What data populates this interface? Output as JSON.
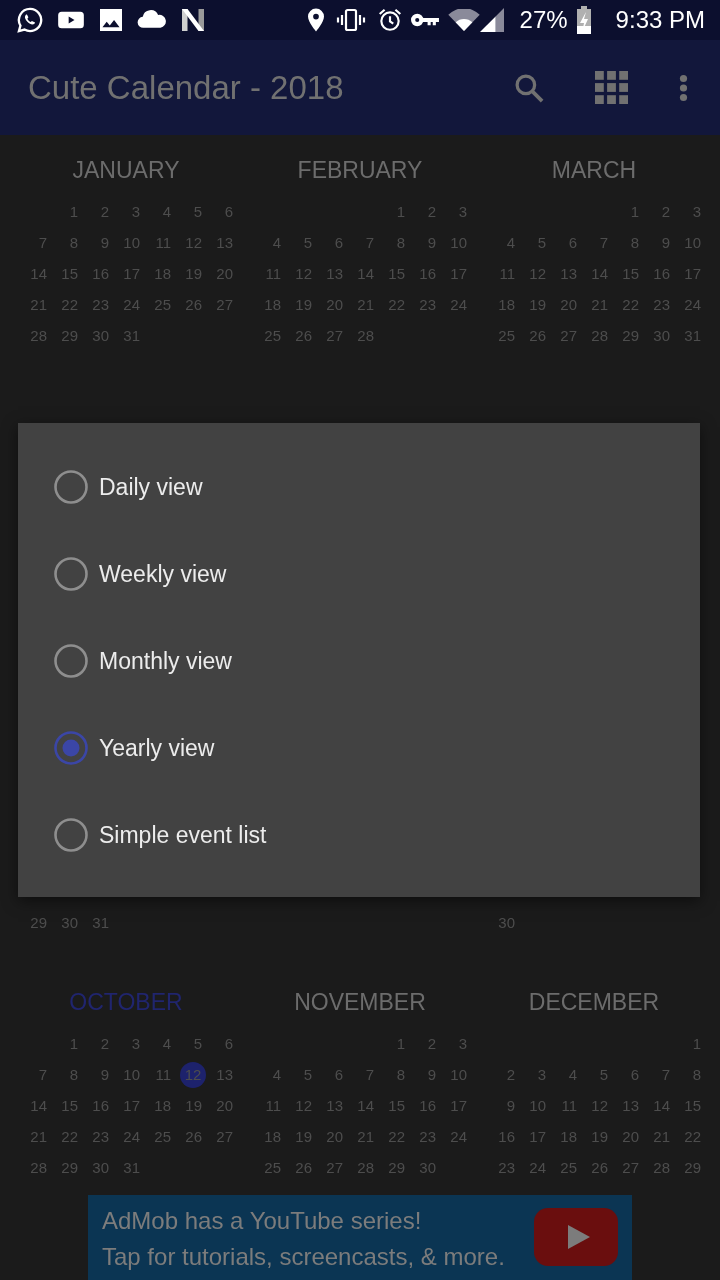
{
  "status_bar": {
    "battery": "27%",
    "time": "9:33 PM"
  },
  "app_bar": {
    "title": "Cute Calendar - 2018"
  },
  "calendar": {
    "upper_months": [
      {
        "name": "JANUARY",
        "current": false,
        "weeks": [
          [
            {
              "day": "1",
              "today": false
            },
            {
              "day": "2",
              "today": false
            },
            {
              "day": "3",
              "today": false
            },
            {
              "day": "4",
              "today": false
            },
            {
              "day": "5",
              "today": false
            },
            {
              "day": "6",
              "today": false
            }
          ],
          [
            {
              "day": "7",
              "today": false
            },
            {
              "day": "8",
              "today": false
            },
            {
              "day": "9",
              "today": false
            },
            {
              "day": "10",
              "today": false
            },
            {
              "day": "11",
              "today": false
            },
            {
              "day": "12",
              "today": false
            },
            {
              "day": "13",
              "today": false
            }
          ],
          [
            {
              "day": "14",
              "today": false
            },
            {
              "day": "15",
              "today": false
            },
            {
              "day": "16",
              "today": false
            },
            {
              "day": "17",
              "today": false
            },
            {
              "day": "18",
              "today": false
            },
            {
              "day": "19",
              "today": false
            },
            {
              "day": "20",
              "today": false
            }
          ],
          [
            {
              "day": "21",
              "today": false
            },
            {
              "day": "22",
              "today": false
            },
            {
              "day": "23",
              "today": false
            },
            {
              "day": "24",
              "today": false
            },
            {
              "day": "25",
              "today": false
            },
            {
              "day": "26",
              "today": false
            },
            {
              "day": "27",
              "today": false
            }
          ],
          [
            {
              "day": "28",
              "today": false
            },
            {
              "day": "29",
              "today": false
            },
            {
              "day": "30",
              "today": false
            },
            {
              "day": "31",
              "today": false
            }
          ]
        ]
      },
      {
        "name": "FEBRUARY",
        "current": false,
        "weeks": [
          [
            {
              "day": "1",
              "today": false
            },
            {
              "day": "2",
              "today": false
            },
            {
              "day": "3",
              "today": false
            }
          ],
          [
            {
              "day": "4",
              "today": false
            },
            {
              "day": "5",
              "today": false
            },
            {
              "day": "6",
              "today": false
            },
            {
              "day": "7",
              "today": false
            },
            {
              "day": "8",
              "today": false
            },
            {
              "day": "9",
              "today": false
            },
            {
              "day": "10",
              "today": false
            }
          ],
          [
            {
              "day": "11",
              "today": false
            },
            {
              "day": "12",
              "today": false
            },
            {
              "day": "13",
              "today": false
            },
            {
              "day": "14",
              "today": false
            },
            {
              "day": "15",
              "today": false
            },
            {
              "day": "16",
              "today": false
            },
            {
              "day": "17",
              "today": false
            }
          ],
          [
            {
              "day": "18",
              "today": false
            },
            {
              "day": "19",
              "today": false
            },
            {
              "day": "20",
              "today": false
            },
            {
              "day": "21",
              "today": false
            },
            {
              "day": "22",
              "today": false
            },
            {
              "day": "23",
              "today": false
            },
            {
              "day": "24",
              "today": false
            }
          ],
          [
            {
              "day": "25",
              "today": false
            },
            {
              "day": "26",
              "today": false
            },
            {
              "day": "27",
              "today": false
            },
            {
              "day": "28",
              "today": false
            }
          ]
        ]
      },
      {
        "name": "MARCH",
        "current": false,
        "weeks": [
          [
            {
              "day": "1",
              "today": false
            },
            {
              "day": "2",
              "today": false
            },
            {
              "day": "3",
              "today": false
            }
          ],
          [
            {
              "day": "4",
              "today": false
            },
            {
              "day": "5",
              "today": false
            },
            {
              "day": "6",
              "today": false
            },
            {
              "day": "7",
              "today": false
            },
            {
              "day": "8",
              "today": false
            },
            {
              "day": "9",
              "today": false
            },
            {
              "day": "10",
              "today": false
            }
          ],
          [
            {
              "day": "11",
              "today": false
            },
            {
              "day": "12",
              "today": false
            },
            {
              "day": "13",
              "today": false
            },
            {
              "day": "14",
              "today": false
            },
            {
              "day": "15",
              "today": false
            },
            {
              "day": "16",
              "today": false
            },
            {
              "day": "17",
              "today": false
            }
          ],
          [
            {
              "day": "18",
              "today": false
            },
            {
              "day": "19",
              "today": false
            },
            {
              "day": "20",
              "today": false
            },
            {
              "day": "21",
              "today": false
            },
            {
              "day": "22",
              "today": false
            },
            {
              "day": "23",
              "today": false
            },
            {
              "day": "24",
              "today": false
            }
          ],
          [
            {
              "day": "25",
              "today": false
            },
            {
              "day": "26",
              "today": false
            },
            {
              "day": "27",
              "today": false
            },
            {
              "day": "28",
              "today": false
            },
            {
              "day": "29",
              "today": false
            },
            {
              "day": "30",
              "today": false
            },
            {
              "day": "31",
              "today": false
            }
          ]
        ]
      }
    ],
    "row_below_dialog": {
      "first_month": [
        {
          "day": "29",
          "today": false
        },
        {
          "day": "30",
          "today": false
        },
        {
          "day": "31",
          "today": false
        }
      ],
      "third_month": [
        {
          "day": "30",
          "today": false
        }
      ]
    },
    "lower_months": [
      {
        "name": "OCTOBER",
        "current": true,
        "weeks": [
          [
            {
              "day": "1",
              "today": false
            },
            {
              "day": "2",
              "today": false
            },
            {
              "day": "3",
              "today": false
            },
            {
              "day": "4",
              "today": false
            },
            {
              "day": "5",
              "today": false
            },
            {
              "day": "6",
              "today": false
            }
          ],
          [
            {
              "day": "7",
              "today": false
            },
            {
              "day": "8",
              "today": false
            },
            {
              "day": "9",
              "today": false
            },
            {
              "day": "10",
              "today": false
            },
            {
              "day": "11",
              "today": false
            },
            {
              "day": "12",
              "today": true
            },
            {
              "day": "13",
              "today": false
            }
          ],
          [
            {
              "day": "14",
              "today": false
            },
            {
              "day": "15",
              "today": false
            },
            {
              "day": "16",
              "today": false
            },
            {
              "day": "17",
              "today": false
            },
            {
              "day": "18",
              "today": false
            },
            {
              "day": "19",
              "today": false
            },
            {
              "day": "20",
              "today": false
            }
          ],
          [
            {
              "day": "21",
              "today": false
            },
            {
              "day": "22",
              "today": false
            },
            {
              "day": "23",
              "today": false
            },
            {
              "day": "24",
              "today": false
            },
            {
              "day": "25",
              "today": false
            },
            {
              "day": "26",
              "today": false
            },
            {
              "day": "27",
              "today": false
            }
          ],
          [
            {
              "day": "28",
              "today": false
            },
            {
              "day": "29",
              "today": false
            },
            {
              "day": "30",
              "today": false
            },
            {
              "day": "31",
              "today": false
            }
          ]
        ]
      },
      {
        "name": "NOVEMBER",
        "current": false,
        "weeks": [
          [
            {
              "day": "1",
              "today": false
            },
            {
              "day": "2",
              "today": false
            },
            {
              "day": "3",
              "today": false
            }
          ],
          [
            {
              "day": "4",
              "today": false
            },
            {
              "day": "5",
              "today": false
            },
            {
              "day": "6",
              "today": false
            },
            {
              "day": "7",
              "today": false
            },
            {
              "day": "8",
              "today": false
            },
            {
              "day": "9",
              "today": false
            },
            {
              "day": "10",
              "today": false
            }
          ],
          [
            {
              "day": "11",
              "today": false
            },
            {
              "day": "12",
              "today": false
            },
            {
              "day": "13",
              "today": false
            },
            {
              "day": "14",
              "today": false
            },
            {
              "day": "15",
              "today": false
            },
            {
              "day": "16",
              "today": false
            },
            {
              "day": "17",
              "today": false
            }
          ],
          [
            {
              "day": "18",
              "today": false
            },
            {
              "day": "19",
              "today": false
            },
            {
              "day": "20",
              "today": false
            },
            {
              "day": "21",
              "today": false
            },
            {
              "day": "22",
              "today": false
            },
            {
              "day": "23",
              "today": false
            },
            {
              "day": "24",
              "today": false
            }
          ],
          [
            {
              "day": "25",
              "today": false
            },
            {
              "day": "26",
              "today": false
            },
            {
              "day": "27",
              "today": false
            },
            {
              "day": "28",
              "today": false
            },
            {
              "day": "29",
              "today": false
            },
            {
              "day": "30",
              "today": false
            }
          ]
        ]
      },
      {
        "name": "DECEMBER",
        "current": false,
        "weeks": [
          [
            {
              "day": "1",
              "today": false
            }
          ],
          [
            {
              "day": "2",
              "today": false
            },
            {
              "day": "3",
              "today": false
            },
            {
              "day": "4",
              "today": false
            },
            {
              "day": "5",
              "today": false
            },
            {
              "day": "6",
              "today": false
            },
            {
              "day": "7",
              "today": false
            },
            {
              "day": "8",
              "today": false
            }
          ],
          [
            {
              "day": "9",
              "today": false
            },
            {
              "day": "10",
              "today": false
            },
            {
              "day": "11",
              "today": false
            },
            {
              "day": "12",
              "today": false
            },
            {
              "day": "13",
              "today": false
            },
            {
              "day": "14",
              "today": false
            },
            {
              "day": "15",
              "today": false
            }
          ],
          [
            {
              "day": "16",
              "today": false
            },
            {
              "day": "17",
              "today": false
            },
            {
              "day": "18",
              "today": false
            },
            {
              "day": "19",
              "today": false
            },
            {
              "day": "20",
              "today": false
            },
            {
              "day": "21",
              "today": false
            },
            {
              "day": "22",
              "today": false
            }
          ],
          [
            {
              "day": "23",
              "today": false
            },
            {
              "day": "24",
              "today": false
            },
            {
              "day": "25",
              "today": false
            },
            {
              "day": "26",
              "today": false
            },
            {
              "day": "27",
              "today": false
            },
            {
              "day": "28",
              "today": false
            },
            {
              "day": "29",
              "today": false
            }
          ]
        ]
      }
    ]
  },
  "dialog": {
    "options": [
      {
        "label": "Daily view",
        "selected": false
      },
      {
        "label": "Weekly view",
        "selected": false
      },
      {
        "label": "Monthly view",
        "selected": false
      },
      {
        "label": "Yearly view",
        "selected": true
      },
      {
        "label": "Simple event list",
        "selected": false
      }
    ]
  },
  "ad_banner": {
    "headline": "AdMob has a YouTube series!",
    "body": "Tap for tutorials, screencasts, & more."
  }
}
